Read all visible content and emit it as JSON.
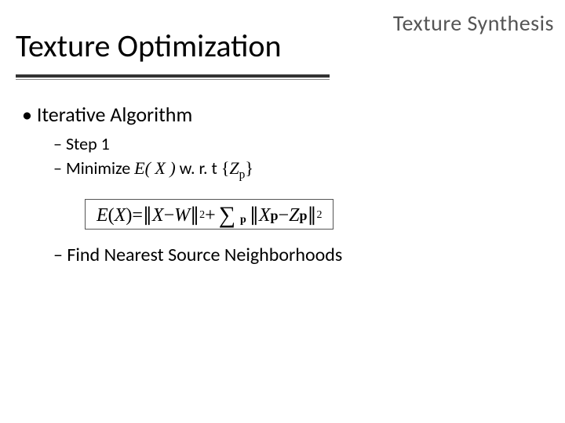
{
  "header": {
    "topic_label": "Texture Synthesis",
    "title": "Texture Optimization"
  },
  "content": {
    "bullet1": "Iterative Algorithm",
    "step1": "Step 1",
    "minimize_prefix": "Minimize ",
    "minimize_expr_E": "E( X )",
    "minimize_wrt": " w. r. t ",
    "minimize_set_open": "{",
    "minimize_set_var": "Z",
    "minimize_set_sub": "p",
    "minimize_set_close": "}",
    "equation": {
      "lhs_E": "E",
      "lhs_open": "(",
      "lhs_X": "X",
      "lhs_close": ")",
      "eq": " = ",
      "bar": "∥",
      "X": "X",
      "minus": " − ",
      "W": "W",
      "sq": "2",
      "plus": " + ",
      "sigma": "∑",
      "sigma_sub": "p",
      "Xp_X": "X",
      "Xp_sub": "p",
      "Zp_Z": "Z",
      "Zp_sub": "p"
    },
    "find_nearest": "Find Nearest Source Neighborhoods"
  }
}
